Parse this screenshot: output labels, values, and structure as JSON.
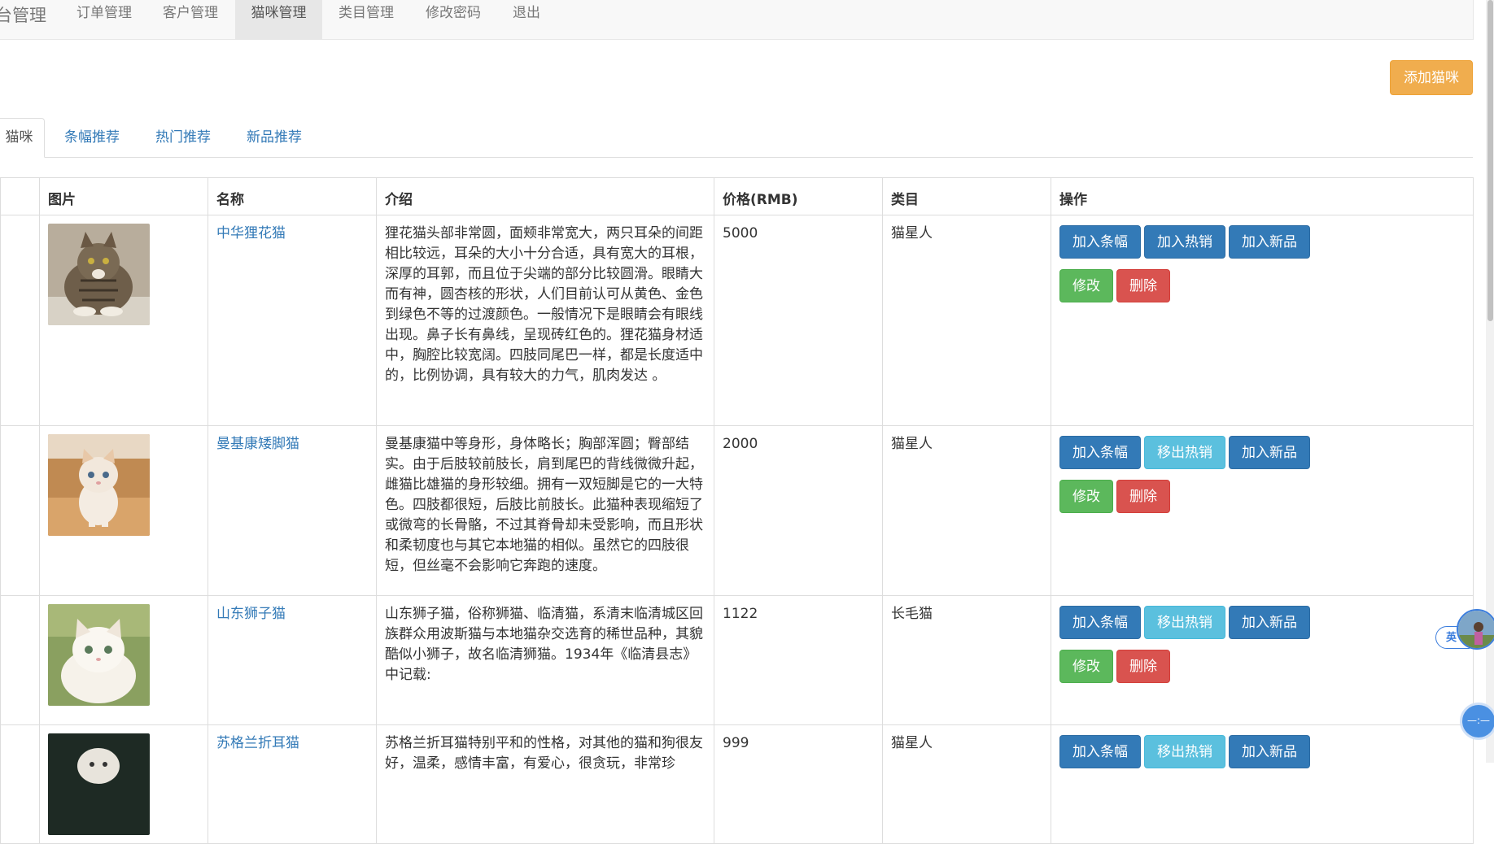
{
  "navbar": {
    "brand": "台管理",
    "items": [
      {
        "label": "订单管理"
      },
      {
        "label": "客户管理"
      },
      {
        "label": "猫咪管理"
      },
      {
        "label": "类目管理"
      },
      {
        "label": "修改密码"
      },
      {
        "label": "退出"
      }
    ]
  },
  "add_button": "添加猫咪",
  "tabs": [
    {
      "label": "猫咪"
    },
    {
      "label": "条幅推荐"
    },
    {
      "label": "热门推荐"
    },
    {
      "label": "新品推荐"
    }
  ],
  "table": {
    "headers": [
      "图片",
      "名称",
      "介绍",
      "价格(RMB)",
      "类目",
      "操作"
    ],
    "rows": [
      {
        "name": "中华狸花猫",
        "intro": "狸花猫头部非常圆，面颊非常宽大，两只耳朵的间距相比较远，耳朵的大小十分合适，具有宽大的耳根，深厚的耳郭，而且位于尖端的部分比较圆滑。眼睛大而有神，圆杏核的形状，人们目前认可从黄色、金色到绿色不等的过渡颜色。一般情况下是眼睛会有眼线出现。鼻子长有鼻线，呈现砖红色的。狸花猫身材适中，胸腔比较宽阔。四肢同尾巴一样，都是长度适中的，比例协调，具有较大的力气，肌肉发达 。",
        "price": "5000",
        "category": "猫星人",
        "hot_label": "加入热销",
        "hot_style": "primary"
      },
      {
        "name": "曼基康矮脚猫",
        "intro": "曼基康猫中等身形，身体略长；胸部浑圆；臀部结实。由于后肢较前肢长，肩到尾巴的背线微微升起，雌猫比雄猫的身形较细。拥有一双短脚是它的一大特色。四肢都很短，后肢比前肢长。此猫种表现缩短了或微弯的长骨骼，不过其脊骨却未受影响，而且形状和柔韧度也与其它本地猫的相似。虽然它的四肢很短，但丝毫不会影响它奔跑的速度。",
        "price": "2000",
        "category": "猫星人",
        "hot_label": "移出热销",
        "hot_style": "info"
      },
      {
        "name": "山东狮子猫",
        "intro": "山东狮子猫，俗称狮猫、临清猫，系清末临清城区回族群众用波斯猫与本地猫杂交选育的稀世品种，其貌酷似小狮子，故名临清狮猫。1934年《临清县志》中记载:",
        "price": "1122",
        "category": "长毛猫",
        "hot_label": "移出热销",
        "hot_style": "info"
      },
      {
        "name": "苏格兰折耳猫",
        "intro": "苏格兰折耳猫特别平和的性格，对其他的猫和狗很友好，温柔，感情丰富，有爱心，很贪玩，非常珍",
        "price": "999",
        "category": "猫星人",
        "hot_label": "移出热销",
        "hot_style": "info"
      }
    ],
    "actions": {
      "banner": "加入条幅",
      "new": "加入新品",
      "edit": "修改",
      "delete": "删除"
    }
  },
  "widgets": {
    "ime": "英"
  }
}
